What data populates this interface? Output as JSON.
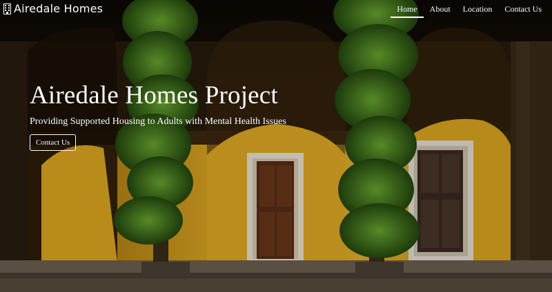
{
  "site": {
    "brand_name": "Airedale Homes",
    "brand_icon": "building-icon"
  },
  "nav": {
    "items": [
      {
        "label": "Home",
        "active": true
      },
      {
        "label": "About",
        "active": false
      },
      {
        "label": "Location",
        "active": false
      },
      {
        "label": "Contact Us",
        "active": false
      }
    ]
  },
  "hero": {
    "title": "Airedale Homes Project",
    "subtitle": "Providing Supported Housing to Adults with Mental Health Issues",
    "cta_label": "Contact Us"
  },
  "colors": {
    "wall": "#d9a21e",
    "shadow": "#1c1409",
    "foliage": "#3f7a1c",
    "door": "#5a2d16",
    "text": "#ffffff"
  }
}
